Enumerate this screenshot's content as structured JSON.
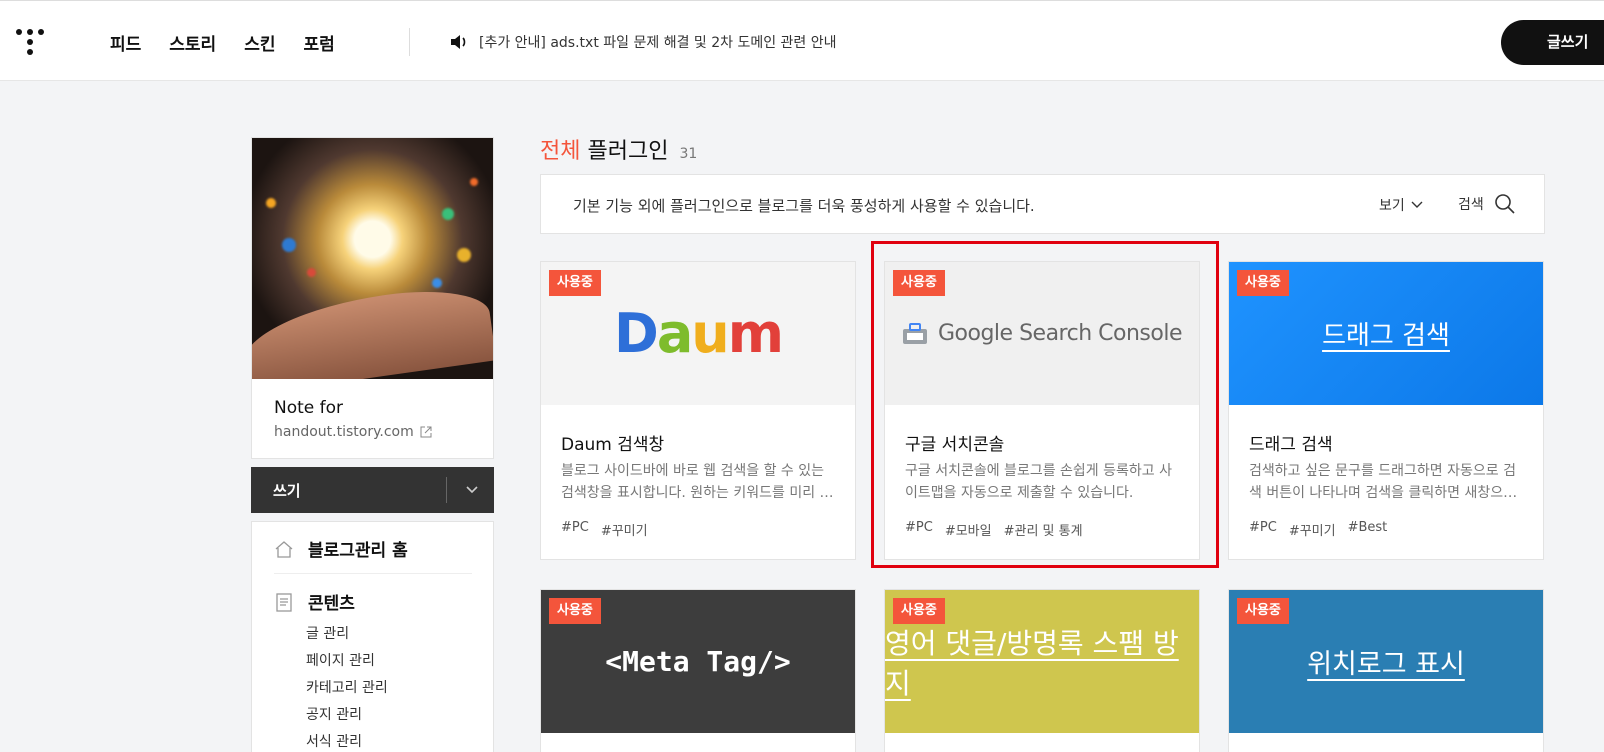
{
  "header": {
    "nav": [
      "피드",
      "스토리",
      "스킨",
      "포럼"
    ],
    "notice": "[추가 안내] ads.txt 파일 문제 해결 및 2차 도메인 관련 안내",
    "write_button": "글쓰기"
  },
  "profile": {
    "name": "Note for",
    "url": "handout.tistory.com"
  },
  "sidebar": {
    "write_label": "쓰기",
    "home_label": "블로그관리 홈",
    "contents_label": "콘텐츠",
    "contents_items": [
      "글 관리",
      "페이지 관리",
      "카테고리 관리",
      "공지 관리",
      "서식 관리"
    ]
  },
  "main": {
    "heading_accent": "전체",
    "heading_rest": "플러그인",
    "heading_count": "31",
    "description": "기본 기능 외에 플러그인으로 블로그를 더욱 풍성하게 사용할 수 있습니다.",
    "view_label": "보기",
    "search_label": "검색",
    "badge_label": "사용중"
  },
  "plugins": [
    {
      "title": "Daum 검색창",
      "thumb_text": "Daum",
      "description": "블로그 사이드바에 바로 웹 검색을 할 수 있는 검색창을 표시합니다. 원하는 키워드를 미리 …",
      "tags": [
        "#PC",
        "#꾸미기"
      ]
    },
    {
      "title": "구글 서치콘솔",
      "thumb_text": "Google Search Console",
      "description": "구글 서치콘솔에 블로그를 손쉽게 등록하고 사이트맵을 자동으로 제출할 수 있습니다.",
      "tags": [
        "#PC",
        "#모바일",
        "#관리 및 통계"
      ]
    },
    {
      "title": "드래그 검색",
      "thumb_text": "드래그 검색",
      "description": "검색하고 싶은 문구를 드래그하면 자동으로 검색 버튼이 나타나며 검색을 클릭하면 새창으…",
      "tags": [
        "#PC",
        "#꾸미기",
        "#Best"
      ]
    },
    {
      "thumb_text": "<Meta Tag/>"
    },
    {
      "thumb_text": "영어 댓글/방명록 스팸 방지"
    },
    {
      "thumb_text": "위치로그 표시"
    }
  ],
  "colors": {
    "accent": "#f4553b",
    "highlight": "#e0000f",
    "drag_bg": "#1a8cf5",
    "meta_bg": "#3d3d3d",
    "spam_bg": "#cfc64e",
    "loc_bg": "#2a7eb3"
  }
}
